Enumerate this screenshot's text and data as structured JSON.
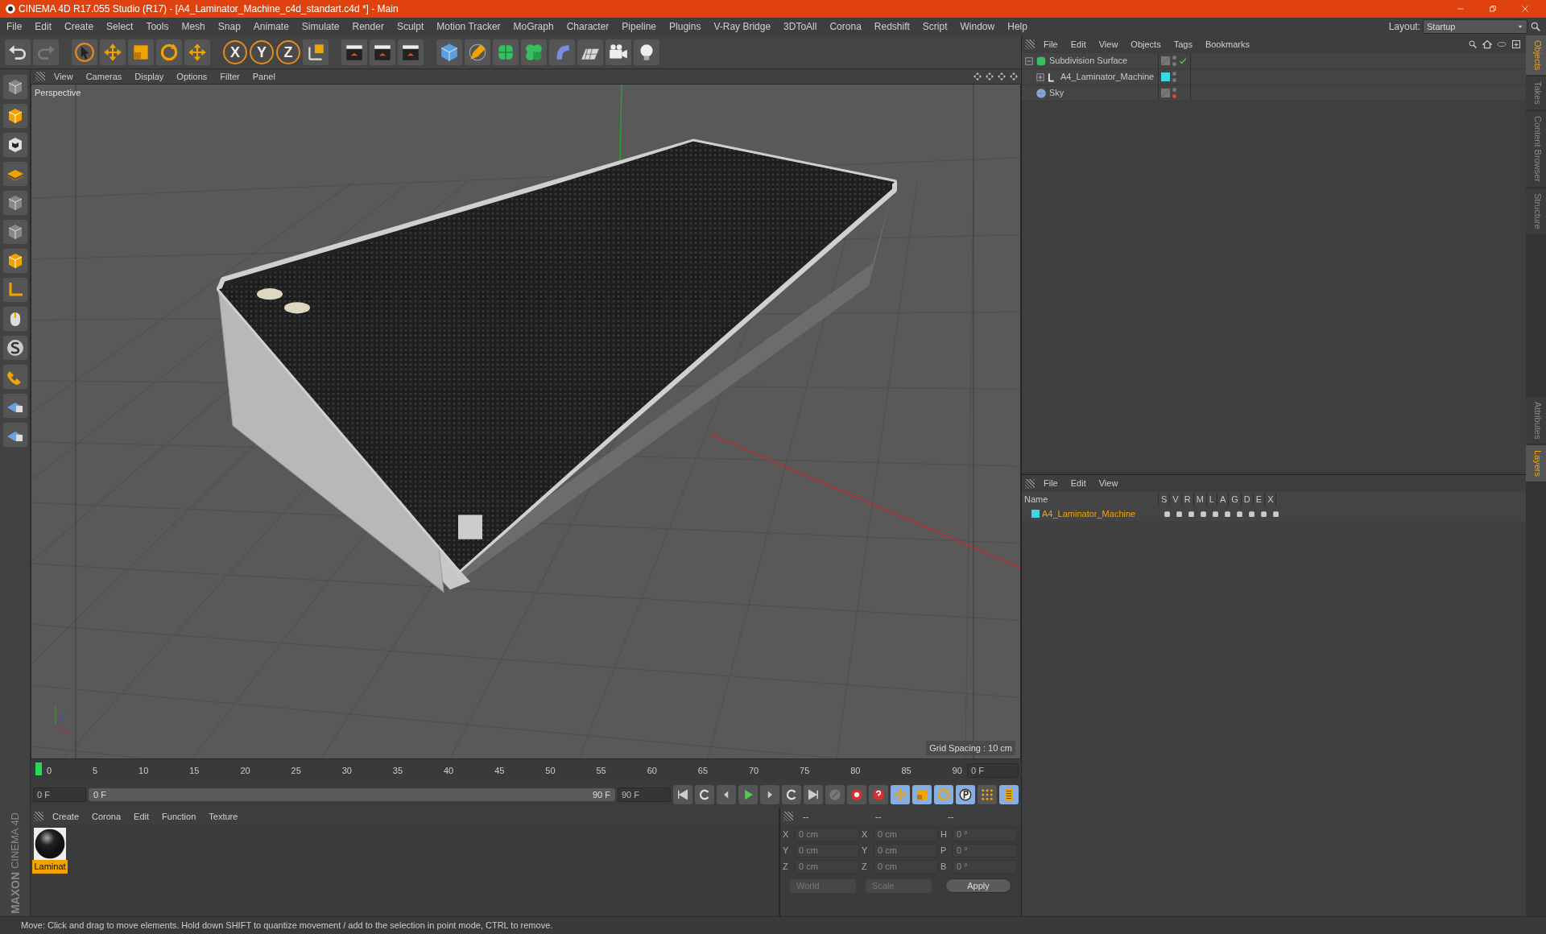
{
  "window": {
    "title": "CINEMA 4D R17.055 Studio (R17) - [A4_Laminator_Machine_c4d_standart.c4d *] - Main"
  },
  "menu_bar": [
    "File",
    "Edit",
    "Create",
    "Select",
    "Tools",
    "Mesh",
    "Snap",
    "Animate",
    "Simulate",
    "Render",
    "Sculpt",
    "Motion Tracker",
    "MoGraph",
    "Character",
    "Pipeline",
    "Plugins",
    "V-Ray Bridge",
    "3DToAll",
    "Corona",
    "Redshift",
    "Script",
    "Window",
    "Help"
  ],
  "layout": {
    "label": "Layout:",
    "value": "Startup"
  },
  "toolbar": {
    "axis_buttons": [
      {
        "label": "X",
        "on": true
      },
      {
        "label": "Y",
        "on": true
      },
      {
        "label": "Z",
        "on": true
      }
    ]
  },
  "brand": [
    "MAXON",
    "CINEMA 4D"
  ],
  "viewport": {
    "menu": [
      "View",
      "Cameras",
      "Display",
      "Options",
      "Filter",
      "Panel"
    ],
    "camera": "Perspective",
    "grid_spacing": "Grid Spacing : 10 cm"
  },
  "timeline": {
    "ticks": [
      "0",
      "5",
      "10",
      "15",
      "20",
      "25",
      "30",
      "35",
      "40",
      "45",
      "50",
      "55",
      "60",
      "65",
      "70",
      "75",
      "80",
      "85",
      "90"
    ],
    "current": "0 F",
    "start": "0 F",
    "range": {
      "start": "0 F",
      "end": "90 F",
      "level": 1
    },
    "end": "90 F"
  },
  "material_manager": {
    "menu": [
      "Create",
      "Corona",
      "Edit",
      "Function",
      "Texture"
    ],
    "materials": [
      {
        "name": "Laminat",
        "selected": true
      }
    ]
  },
  "coordinates": {
    "headers": [
      "--",
      "--",
      "--"
    ],
    "columns": [
      [
        {
          "axis": "X",
          "value": "0 cm"
        },
        {
          "axis": "Y",
          "value": "0 cm"
        },
        {
          "axis": "Z",
          "value": "0 cm"
        }
      ],
      [
        {
          "axis": "X",
          "value": "0 cm"
        },
        {
          "axis": "Y",
          "value": "0 cm"
        },
        {
          "axis": "Z",
          "value": "0 cm"
        }
      ],
      [
        {
          "axis": "H",
          "value": "0 °"
        },
        {
          "axis": "P",
          "value": "0 °"
        },
        {
          "axis": "B",
          "value": "0 °"
        }
      ]
    ],
    "dropdowns": [
      "World",
      "Scale"
    ],
    "apply": "Apply"
  },
  "object_manager": {
    "menu": [
      "File",
      "Edit",
      "View",
      "Objects",
      "Tags",
      "Bookmarks"
    ],
    "objects": [
      {
        "name": "Subdivision Surface",
        "kind": "subdivision",
        "expanded": true,
        "enabled": true,
        "render_visible": true,
        "children": [
          {
            "name": "A4_Laminator_Machine",
            "kind": "null",
            "expanded": false,
            "color": "#3ed6e0",
            "render_visible": true
          }
        ]
      },
      {
        "name": "Sky",
        "kind": "sky",
        "render_visible": false
      }
    ]
  },
  "side_tabs_top": [
    {
      "label": "Objects",
      "selected": true
    },
    {
      "label": "Takes",
      "selected": false
    },
    {
      "label": "Content Browser",
      "selected": false
    },
    {
      "label": "Structure",
      "selected": false
    }
  ],
  "layer_manager": {
    "menu": [
      "File",
      "Edit",
      "View"
    ],
    "columns": [
      "Name",
      "S",
      "V",
      "R",
      "M",
      "L",
      "A",
      "G",
      "D",
      "E",
      "X"
    ],
    "layers": [
      {
        "name": "A4_Laminator_Machine",
        "color": "#3ed6e0"
      }
    ]
  },
  "side_tabs_bottom": [
    {
      "label": "Attributes",
      "selected": false
    },
    {
      "label": "Layers",
      "selected": true
    }
  ],
  "status_bar": "Move: Click and drag to move elements. Hold down SHIFT to quantize movement / add to the selection in point mode, CTRL to remove."
}
